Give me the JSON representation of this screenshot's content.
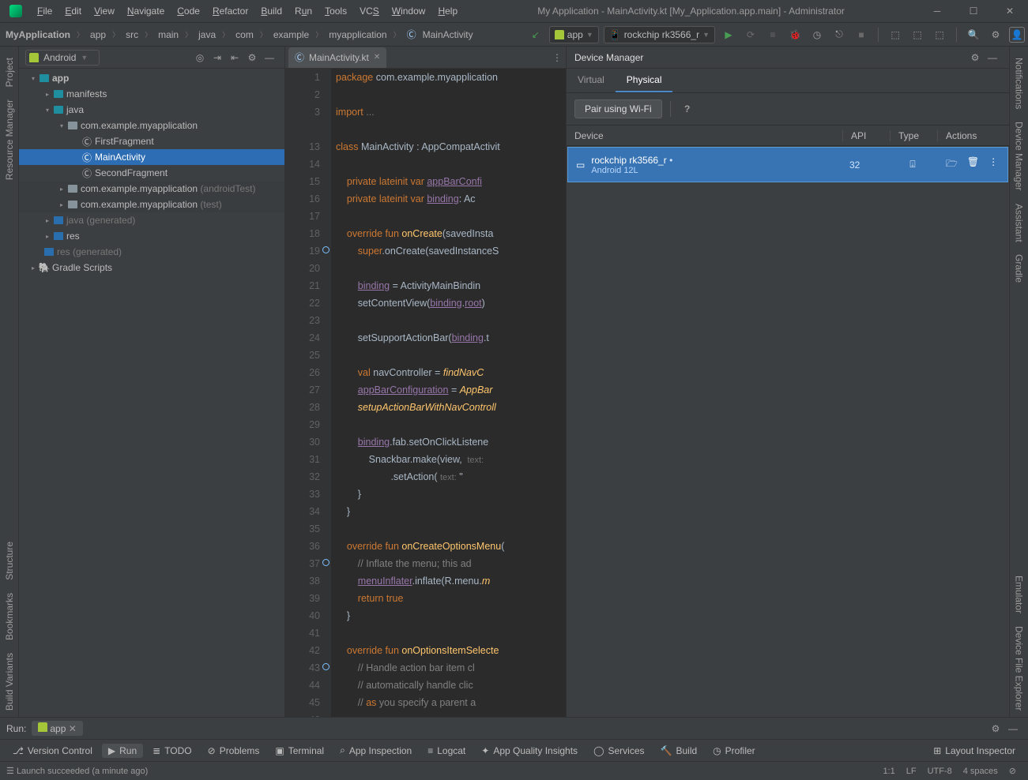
{
  "title": "My Application - MainActivity.kt [My_Application.app.main] - Administrator",
  "menu": [
    "File",
    "Edit",
    "View",
    "Navigate",
    "Code",
    "Refactor",
    "Build",
    "Run",
    "Tools",
    "VCS",
    "Window",
    "Help"
  ],
  "breadcrumbs": [
    "MyApplication",
    "app",
    "src",
    "main",
    "java",
    "com",
    "example",
    "myapplication",
    "MainActivity"
  ],
  "run_config": "app",
  "device_target": "rockchip rk3566_r",
  "project_view": "Android",
  "tree": {
    "app": "app",
    "manifests": "manifests",
    "java": "java",
    "pkg": "com.example.myapplication",
    "FirstFragment": "FirstFragment",
    "MainActivity": "MainActivity",
    "SecondFragment": "SecondFragment",
    "pkg_at": "com.example.myapplication",
    "at": "(androidTest)",
    "pkg_t": "com.example.myapplication",
    "t": "(test)",
    "java_gen": "java",
    "gen": "(generated)",
    "res": "res",
    "res_gen": "res",
    "gen2": "(generated)",
    "gradle": "Gradle Scripts"
  },
  "tab": "MainActivity.kt",
  "code_lines": [
    "package com.example.myapplication",
    "",
    "import ...",
    "",
    "class MainActivity : AppCompatActivit",
    "",
    "    private lateinit var appBarConfi",
    "    private lateinit var binding: Ac",
    "",
    "    override fun onCreate(savedInsta",
    "        super.onCreate(savedInstance",
    "",
    "        binding = ActivityMainBindin",
    "        setContentView(binding.root)",
    "",
    "        setSupportActionBar(binding.",
    "",
    "        val navController = findNavC",
    "        appBarConfiguration = AppBar",
    "        setupActionBarWithNavControl",
    "",
    "        binding.fab.setOnClickListen",
    "            Snackbar.make(view,",
    "                    .setAction(",
    "        }",
    "    }",
    "",
    "    override fun onCreateOptionsMenu",
    "        // Inflate the menu; this ad",
    "        menuInflater.inflate(R.menu.",
    "        return true",
    "    }",
    "",
    "    override fun onOptionsItemSelect",
    "        // Handle action bar item cl",
    "        // automatically handle clic",
    "        // as you specify a parent a"
  ],
  "line_start": 1,
  "device_manager": {
    "title": "Device Manager",
    "tabs": [
      "Virtual",
      "Physical"
    ],
    "pair_btn": "Pair using Wi-Fi",
    "cols": [
      "Device",
      "API",
      "Type",
      "Actions"
    ],
    "row": {
      "name": "rockchip rk3566_r",
      "sub": "Android 12L",
      "api": "32"
    }
  },
  "left_tabs": [
    "Project",
    "Resource Manager",
    "Structure",
    "Bookmarks",
    "Build Variants"
  ],
  "right_tabs": [
    "Notifications",
    "Device Manager",
    "Assistant",
    "Gradle",
    "Emulator",
    "Device File Explorer"
  ],
  "run_tab": {
    "label": "Run:",
    "config": "app"
  },
  "bottom_tabs": [
    "Version Control",
    "Run",
    "TODO",
    "Problems",
    "Terminal",
    "App Inspection",
    "Logcat",
    "App Quality Insights",
    "Services",
    "Build",
    "Profiler",
    "Layout Inspector"
  ],
  "status": {
    "msg": "Launch succeeded (a minute ago)",
    "pos": "1:1",
    "enc": "LF",
    "cs": "UTF-8",
    "indent": "4 spaces"
  }
}
